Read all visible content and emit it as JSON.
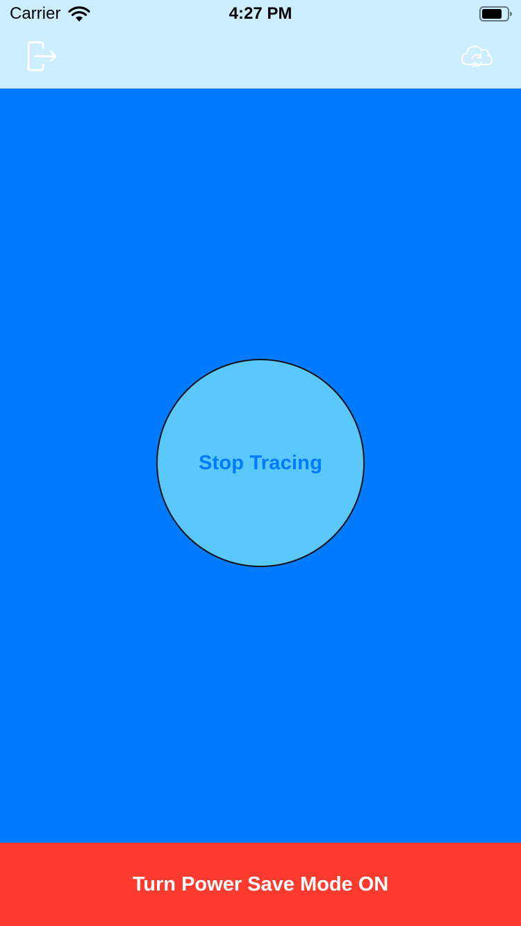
{
  "status_bar": {
    "carrier": "Carrier",
    "time": "4:27 PM",
    "wifi_icon": "wifi-icon",
    "battery_icon": "battery-icon"
  },
  "nav": {
    "left_icon": "logout-icon",
    "right_icon": "cloud-sync-icon"
  },
  "main": {
    "trace_button_label": "Stop Tracing"
  },
  "footer": {
    "power_save_label": "Turn Power Save Mode ON"
  },
  "colors": {
    "background": "#007aff",
    "header": "#cdeefe",
    "trace_button": "#5ac8fa",
    "trace_label": "#007aff",
    "power_bar": "#ff3b30"
  }
}
